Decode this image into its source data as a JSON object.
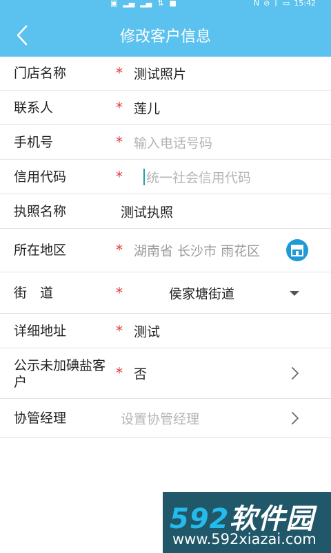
{
  "status_bar": {
    "left_icons": [
      "hd-icon",
      "signal-icon",
      "signal-icon",
      "data-icon",
      "alert-icon"
    ],
    "right_icons": [
      "nfc-icon",
      "mute-icon",
      "bluetooth-icon",
      "battery-icon"
    ],
    "time": "15:42"
  },
  "header": {
    "title": "修改客户信息",
    "background": "#5bc1ee"
  },
  "form": {
    "store_name": {
      "label": "门店名称",
      "required": "*",
      "value": "测试照片"
    },
    "contact": {
      "label": "联系人",
      "required": "*",
      "value": "莲儿"
    },
    "phone": {
      "label": "手机号",
      "required": "*",
      "placeholder": "输入电话号码"
    },
    "credit_code": {
      "label": "信用代码",
      "required": "*",
      "placeholder": "统一社会信用代码"
    },
    "license_name": {
      "label": "执照名称",
      "value": "测试执照"
    },
    "region": {
      "label": "所在地区",
      "required": "*",
      "value": "湖南省 长沙市 雨花区"
    },
    "street": {
      "label": "街　道",
      "required": "*",
      "value": "侯家塘街道"
    },
    "address": {
      "label": "详细地址",
      "required": "*",
      "value": "测试"
    },
    "salt": {
      "label_line1": "公示未加碘盐客",
      "label_line2": "户",
      "required": "*",
      "value": "否"
    },
    "manager": {
      "label": "协管经理",
      "placeholder": "设置协管经理"
    }
  },
  "watermark": {
    "logo_part1": "592",
    "logo_part2": "软件园",
    "url": "www.592xiazai.com"
  },
  "colors": {
    "accent": "#5bc1ee",
    "required": "#e23b3b",
    "location_button": "#1d9ad7"
  }
}
